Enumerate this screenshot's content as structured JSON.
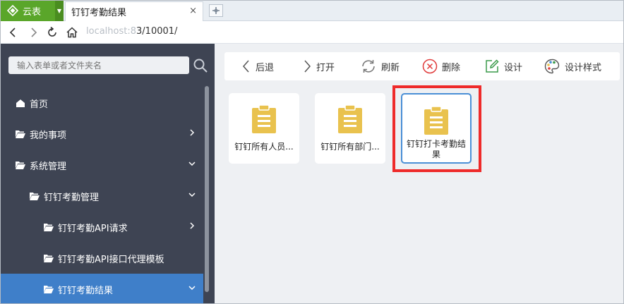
{
  "tabbar": {
    "brand": "云表",
    "tab_title": "钉钉考勤结果",
    "close": "×"
  },
  "address": {
    "url_blurred": "localhost:8",
    "url_rest": "3/10001/"
  },
  "sidebar": {
    "search_placeholder": "输入表单或者文件夹名",
    "items": [
      {
        "label": "首页"
      },
      {
        "label": "我的事项"
      },
      {
        "label": "系统管理"
      },
      {
        "label": "钉钉考勤管理"
      },
      {
        "label": "钉钉考勤API请求"
      },
      {
        "label": "钉钉考勤API接口代理模板"
      },
      {
        "label": "钉钉考勤结果"
      }
    ]
  },
  "toolbar": {
    "back": "后退",
    "open": "打开",
    "refresh": "刷新",
    "delete": "删除",
    "design": "设计",
    "design_style": "设计样式"
  },
  "cards": [
    {
      "label": "钉钉所有人员..."
    },
    {
      "label": "钉钉所有部门..."
    },
    {
      "label": "钉钉打卡考勤结果"
    }
  ],
  "colors": {
    "brand_green": "#5aa62a",
    "sidebar_bg": "#3e4453",
    "active_item": "#3f7fc9",
    "form_icon": "#e9c24e",
    "highlight": "#ee2a2a"
  }
}
